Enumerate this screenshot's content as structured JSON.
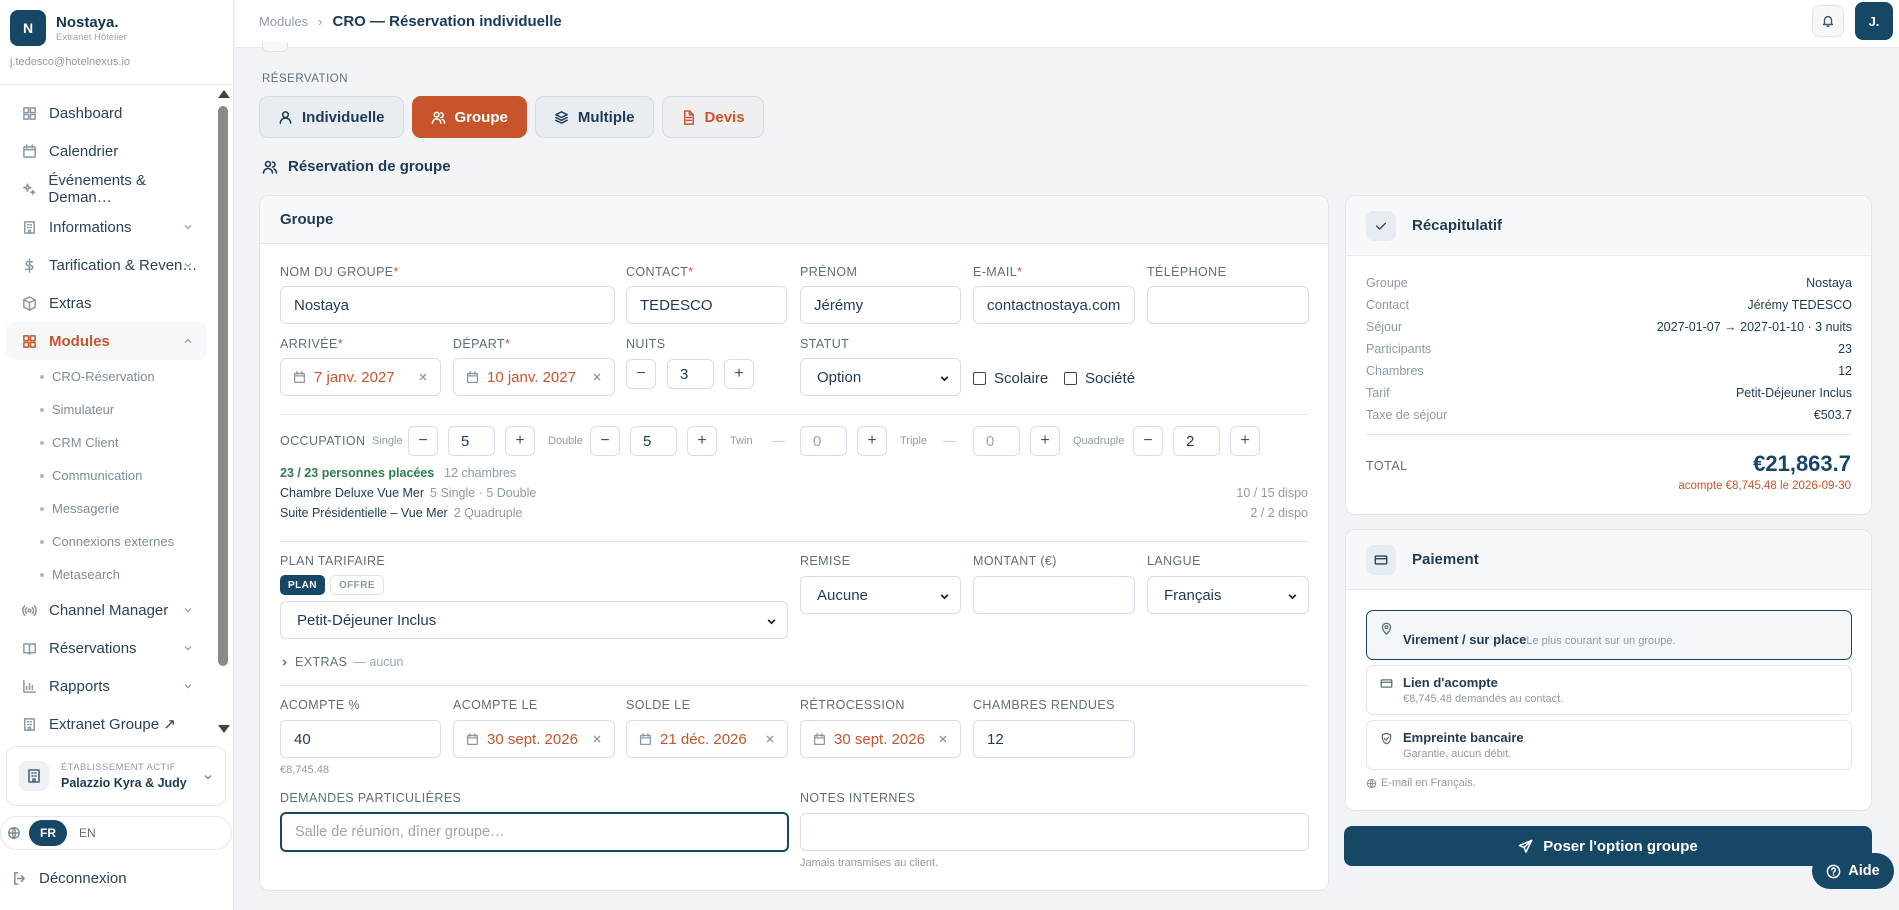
{
  "brand": {
    "initial": "N",
    "name": "Nostaya.",
    "subtitle": "Extranet Hôtelier",
    "email": "j.tedesco@hotelnexus.io"
  },
  "nav": {
    "dashboard": "Dashboard",
    "calendar": "Calendrier",
    "events": "Événements & Deman…",
    "infos": "Informations",
    "pricing": "Tarification & Reven…",
    "extras": "Extras",
    "modules": "Modules",
    "subs": [
      "CRO-Réservation",
      "Simulateur",
      "CRM Client",
      "Communication",
      "Messagerie",
      "Connexions externes",
      "Metasearch"
    ],
    "channel": "Channel Manager",
    "reservations": "Réservations",
    "reports": "Rapports",
    "extranet_group": "Extranet Groupe ↗"
  },
  "establishment": {
    "label": "ÉTABLISSEMENT ACTIF",
    "name": "Palazzio Kyra & Judy"
  },
  "language": {
    "active": "FR",
    "other": "EN"
  },
  "logout": "Déconnexion",
  "topbar": {
    "crumb_root": "Modules",
    "crumb_sep": "›",
    "crumb_current": "CRO — Réservation individuelle",
    "avatar": "J."
  },
  "main": {
    "section_label": "RÉSERVATION",
    "modes": {
      "individual": "Individuelle",
      "group": "Groupe",
      "multiple": "Multiple",
      "quote": "Devis"
    },
    "page_heading": "Réservation de groupe",
    "card_title": "Groupe"
  },
  "form": {
    "group_name": {
      "label": "NOM DU GROUPE",
      "value": "Nostaya"
    },
    "contact": {
      "label": "CONTACT",
      "value": "TEDESCO"
    },
    "firstname": {
      "label": "PRÉNOM",
      "value": "Jérémy"
    },
    "email": {
      "label": "E-MAIL",
      "value": "contactnostaya.com"
    },
    "phone": {
      "label": "TÉLÉPHONE",
      "value": ""
    },
    "arrival": {
      "label": "ARRIVÉE",
      "value": "7 janv. 2027"
    },
    "departure": {
      "label": "DÉPART",
      "value": "10 janv. 2027"
    },
    "nights": {
      "label": "NUITS",
      "value": "3"
    },
    "status": {
      "label": "STATUT",
      "value": "Option"
    },
    "school": "Scolaire",
    "company": "Société",
    "required_mark": "*",
    "minus": "−",
    "plus": "+",
    "dash": "—",
    "occupation": {
      "label": "OCCUPATION",
      "single": {
        "label": "Single",
        "value": "5"
      },
      "double": {
        "label": "Double",
        "value": "5"
      },
      "twin": {
        "label": "Twin",
        "value": "0"
      },
      "triple": {
        "label": "Triple",
        "value": "0"
      },
      "quad": {
        "label": "Quadruple",
        "value": "2"
      },
      "placed": "23 / 23 personnes placées",
      "rooms_count": "12 chambres",
      "rooms": [
        {
          "name": "Chambre Deluxe Vue Mer",
          "detail": "5 Single · 5 Double",
          "avail": "10 / 15 dispo"
        },
        {
          "name": "Suite Présidentielle – Vue Mer",
          "detail": "2 Quadruple",
          "avail": "2 / 2 dispo"
        }
      ]
    },
    "rate_plan": {
      "label": "PLAN TARIFAIRE",
      "plan": "PLAN",
      "offer": "OFFRE",
      "value": "Petit-Déjeuner Inclus"
    },
    "discount": {
      "label": "REMISE",
      "value": "Aucune"
    },
    "amount": {
      "label": "MONTANT (€)",
      "value": ""
    },
    "lang": {
      "label": "LANGUE",
      "value": "Français"
    },
    "extras": {
      "label": "EXTRAS",
      "value": "— aucun"
    },
    "deposit_pct": {
      "label": "ACOMPTE %",
      "value": "40",
      "hint": "€8,745.48"
    },
    "deposit_date": {
      "label": "ACOMPTE LE",
      "value": "30 sept. 2026"
    },
    "balance_date": {
      "label": "SOLDE LE",
      "value": "21 déc. 2026"
    },
    "release_date": {
      "label": "RÉTROCESSION",
      "value": "30 sept. 2026"
    },
    "rooms_returned": {
      "label": "CHAMBRES RENDUES",
      "value": "12"
    },
    "special_requests": {
      "label": "DEMANDES PARTICULIÈRES",
      "placeholder": "Salle de réunion, dîner groupe…"
    },
    "internal_notes": {
      "label": "NOTES INTERNES",
      "hint": "Jamais transmises au client."
    }
  },
  "summary": {
    "title": "Récapitulatif",
    "rows": [
      {
        "k": "Groupe",
        "v": "Nostaya"
      },
      {
        "k": "Contact",
        "v": "Jérémy TEDESCO"
      },
      {
        "k": "Séjour",
        "v": "2027-01-07 → 2027-01-10 · 3 nuits"
      },
      {
        "k": "Participants",
        "v": "23"
      },
      {
        "k": "Chambres",
        "v": "12"
      },
      {
        "k": "Tarif",
        "v": "Petit-Déjeuner Inclus"
      },
      {
        "k": "Taxe de séjour",
        "v": "€503.7"
      }
    ],
    "total_label": "TOTAL",
    "total_value": "€21,863.7",
    "deposit_note": "acompte €8,745.48 le 2026-09-30"
  },
  "payment": {
    "title": "Paiement",
    "options": [
      {
        "title": "Virement / sur place",
        "sub": "Le plus courant sur un groupe."
      },
      {
        "title": "Lien d'acompte",
        "sub": "€8,745.48 demandés au contact."
      },
      {
        "title": "Empreinte bancaire",
        "sub": "Garantie, aucun débit."
      }
    ],
    "note": "E-mail en Français."
  },
  "cta": "Poser l'option groupe",
  "help": "Aide",
  "colors": {
    "primary": "#174766",
    "accent": "#c8542c",
    "success": "#2e7d4f"
  }
}
